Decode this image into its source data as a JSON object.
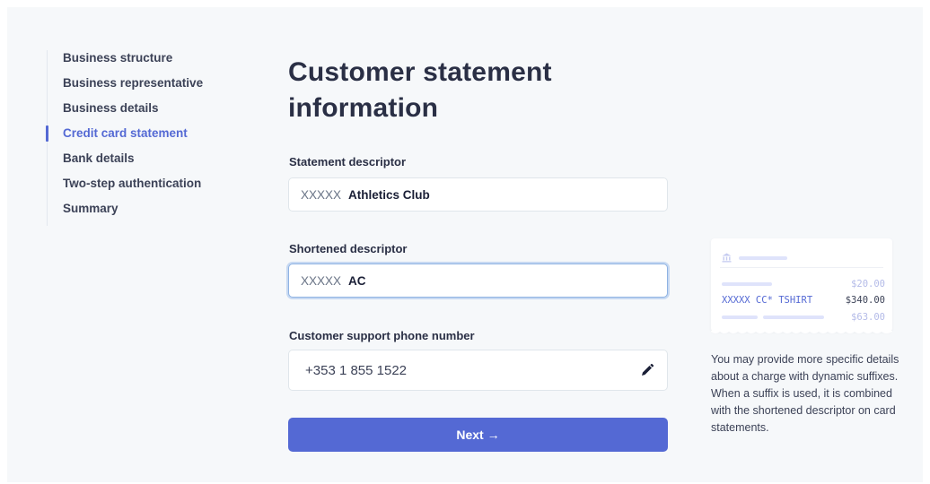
{
  "sidebar": {
    "items": [
      {
        "label": "Business structure",
        "active": false
      },
      {
        "label": "Business representative",
        "active": false
      },
      {
        "label": "Business details",
        "active": false
      },
      {
        "label": "Credit card statement",
        "active": true
      },
      {
        "label": "Bank details",
        "active": false
      },
      {
        "label": "Two-step authentication",
        "active": false
      },
      {
        "label": "Summary",
        "active": false
      }
    ]
  },
  "main": {
    "title": "Customer statement information",
    "statement_descriptor": {
      "label": "Statement descriptor",
      "prefix": "XXXXX",
      "value": "Athletics Club"
    },
    "shortened_descriptor": {
      "label": "Shortened descriptor",
      "prefix": "XXXXX",
      "value": "AC"
    },
    "support_phone": {
      "label": "Customer support phone number",
      "value": "+353 1 855 1522",
      "icon": "pencil-icon"
    },
    "next_label": "Next →"
  },
  "preview": {
    "icon": "bank-icon",
    "rows": [
      {
        "descriptor": "",
        "amount": "$20.00"
      },
      {
        "descriptor": "XXXXX CC* TSHIRT",
        "amount": "$340.00"
      },
      {
        "descriptor": "",
        "amount": "$63.00"
      }
    ],
    "help_text": "You may provide more specific details about a charge with dynamic suffixes. When a suffix is used, it is combined with the shortened descriptor on card statements."
  },
  "colors": {
    "accent": "#5469d4",
    "background": "#f6f8fa",
    "text": "#3c4257"
  }
}
